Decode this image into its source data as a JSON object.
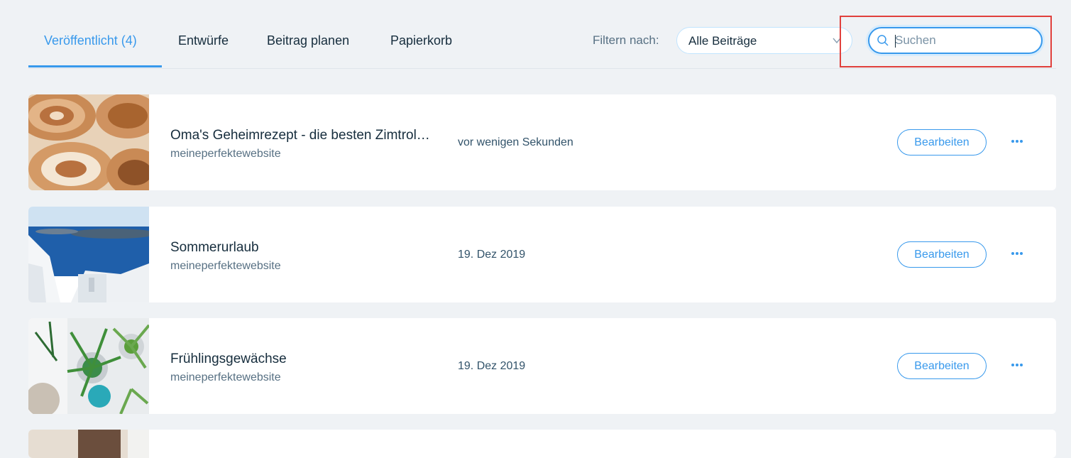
{
  "tabs": [
    {
      "label": "Veröffentlicht (4)",
      "active": true
    },
    {
      "label": "Entwürfe",
      "active": false
    },
    {
      "label": "Beitrag planen",
      "active": false
    },
    {
      "label": "Papierkorb",
      "active": false
    }
  ],
  "filter": {
    "label": "Filtern nach:",
    "selected": "Alle Beiträge"
  },
  "search": {
    "placeholder": "Suchen",
    "value": ""
  },
  "posts": [
    {
      "title": "Oma's Geheimrezept - die besten Zimtrol…",
      "site": "meineperfektewebsite",
      "date": "vor wenigen Sekunden",
      "edit_label": "Bearbeiten",
      "image": "cinnamon-rolls-image"
    },
    {
      "title": "Sommerurlaub",
      "site": "meineperfektewebsite",
      "date": "19. Dez 2019",
      "edit_label": "Bearbeiten",
      "image": "santorini-sea-image"
    },
    {
      "title": "Frühlingsgewächse",
      "site": "meineperfektewebsite",
      "date": "19. Dez 2019",
      "edit_label": "Bearbeiten",
      "image": "plants-image"
    }
  ],
  "colors": {
    "accent": "#3899ec",
    "text": "#162d3d",
    "background": "#eff2f5",
    "highlight": "#e0403c"
  }
}
